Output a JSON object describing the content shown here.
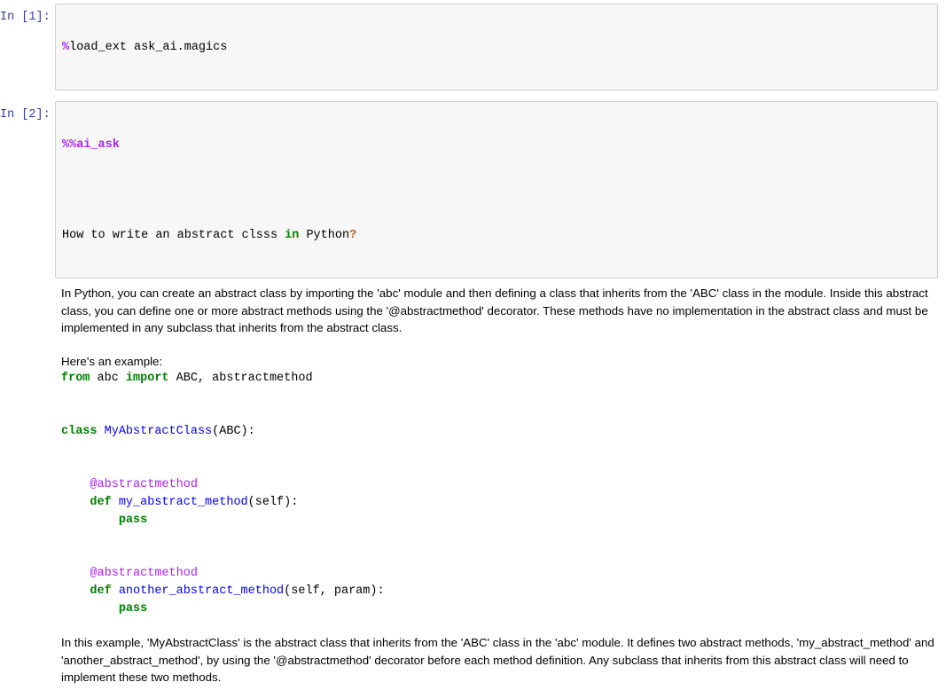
{
  "notebook": {
    "cells": [
      {
        "prompt": "In [1]:",
        "type": "code",
        "source": "%load_ext ask_ai.magics",
        "magic": "%",
        "rest": "load_ext ask_ai.magics"
      },
      {
        "prompt": "In [2]:",
        "type": "code",
        "magic": "%%ai_ask",
        "question_parts": {
          "p1": "How to write an abstract clsss ",
          "kw": "in",
          "p2": " Python",
          "q": "?"
        },
        "question_full": "How to write an abstract clsss in Python?"
      }
    ],
    "output": {
      "paragraph_1": "In Python, you can create an abstract class by importing the 'abc' module and then defining a class that inherits from the 'ABC' class in the module. Inside this abstract class, you can define one or more abstract methods using the '@abstractmethod' decorator. These methods have no implementation in the abstract class and must be implemented in any subclass that inherits from the abstract class.",
      "example_lead": "Here's an example:",
      "code": {
        "line_import": {
          "kw_from": "from",
          "mod": " abc ",
          "kw_import": "import",
          "names": " ABC, abstractmethod"
        },
        "line_class": {
          "kw_class": "class",
          "space": " ",
          "class_name": "MyAbstractClass",
          "tail": "(ABC):"
        },
        "decorator_1": "    @abstractmethod",
        "method_1": {
          "indent": "    ",
          "kw_def": "def",
          "space": " ",
          "name": "my_abstract_method",
          "tail": "(self):"
        },
        "pass_1_indent": "        ",
        "pass_1": "pass",
        "decorator_2": "    @abstractmethod",
        "method_2": {
          "indent": "    ",
          "kw_def": "def",
          "space": " ",
          "name": "another_abstract_method",
          "tail": "(self, param):"
        },
        "pass_2_indent": "        ",
        "pass_2": "pass"
      },
      "paragraph_2": "In this example, 'MyAbstractClass' is the abstract class that inherits from the 'ABC' class in the 'abc' module. It defines two abstract methods, 'my_abstract_method' and 'another_abstract_method', by using the '@abstractmethod' decorator before each method definition. Any subclass that inherits from this abstract class will need to implement these two methods."
    }
  },
  "colors": {
    "prompt_blue": "#303F9F",
    "keyword_green": "#008000",
    "name_blue": "#0000FF",
    "magic_purple": "#AA22FF",
    "question_mark_orange": "#BB6622",
    "cell_background": "#f7f7f7",
    "cell_border": "#cfcfcf"
  }
}
